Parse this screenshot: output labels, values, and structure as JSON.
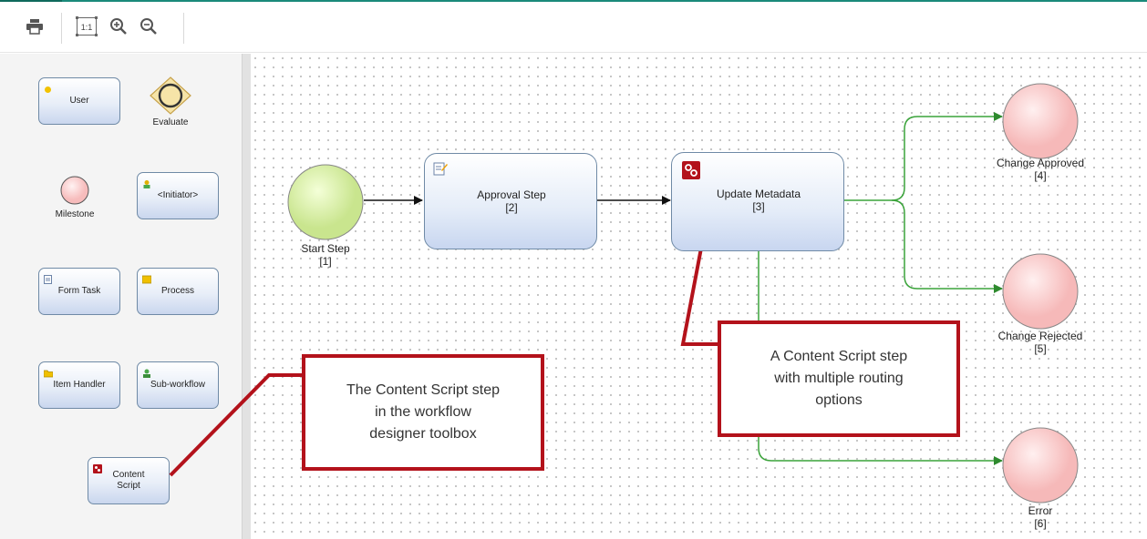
{
  "toolbar": {
    "print": "printer-icon",
    "actual_size": "actual-size-icon",
    "zoom_in": "zoom-in-icon",
    "zoom_out": "zoom-out-icon"
  },
  "toolbox": {
    "user": "User",
    "evaluate": "Evaluate",
    "milestone": "Milestone",
    "initiator": "<Initiator>",
    "form_task": "Form Task",
    "process": "Process",
    "item_handler": "Item Handler",
    "sub_workflow": "Sub-workflow",
    "content_script_line1": "Content",
    "content_script_line2": "Script"
  },
  "workflow": {
    "start": {
      "name": "Start Step",
      "id": "[1]"
    },
    "approval": {
      "name": "Approval Step",
      "id": "[2]"
    },
    "update": {
      "name": "Update Metadata",
      "id": "[3]"
    },
    "approved": {
      "name": "Change Approved",
      "id": "[4]"
    },
    "rejected": {
      "name": "Change Rejected",
      "id": "[5]"
    },
    "error": {
      "name": "Error",
      "id": "[6]"
    }
  },
  "callouts": {
    "toolbox_line1": "The Content Script step",
    "toolbox_line2": "in the workflow",
    "toolbox_line3": "designer toolbox",
    "routing_line1": "A Content Script step",
    "routing_line2": "with multiple routing",
    "routing_line3": "options"
  },
  "colors": {
    "callout_border": "#b3121b",
    "route_line": "#3aa33a",
    "start_circle": "#d6ee9e",
    "end_circle": "#f9cfcf"
  }
}
